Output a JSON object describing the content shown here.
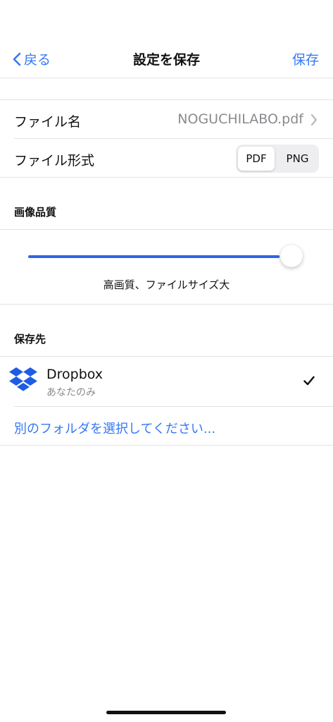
{
  "nav": {
    "back_label": "戻る",
    "title": "設定を保存",
    "save_label": "保存"
  },
  "file": {
    "name_label": "ファイル名",
    "name_value": "NOGUCHILABO.pdf",
    "format_label": "ファイル形式",
    "formats": [
      "PDF",
      "PNG"
    ],
    "selected_format": "PDF"
  },
  "quality": {
    "header": "画像品質",
    "slider_value_fraction": 0.95,
    "caption": "高画質、ファイルサイズ大"
  },
  "destination": {
    "header": "保存先",
    "service_name": "Dropbox",
    "service_subtitle": "あなたのみ",
    "selected": true,
    "choose_other_label": "別のフォルダを選択してください..."
  },
  "colors": {
    "accent": "#3478f6",
    "slider_fill": "#2f66e4",
    "dropbox": "#1f5ce6",
    "secondary_text": "#8a8a8e",
    "divider": "#e3e3e6"
  },
  "icons": {
    "back": "chevron-left-icon",
    "disclosure": "chevron-right-icon",
    "service": "dropbox-icon",
    "selected": "checkmark-icon"
  }
}
